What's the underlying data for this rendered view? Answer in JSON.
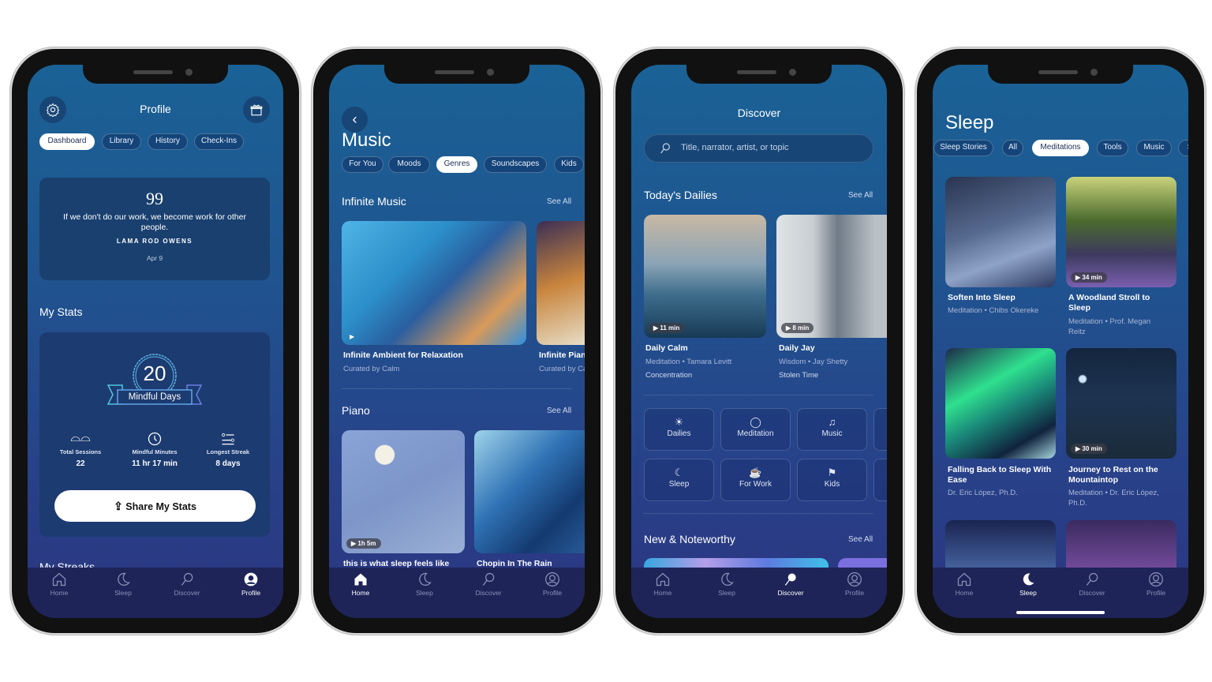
{
  "tabbar": {
    "home": "Home",
    "sleep": "Sleep",
    "discover": "Discover",
    "profile": "Profile"
  },
  "profile": {
    "title": "Profile",
    "tabs": [
      "Dashboard",
      "Library",
      "History",
      "Check-Ins"
    ],
    "quote": {
      "mark": "99",
      "text": "If we don't do our work, we become work for other people.",
      "author": "LAMA ROD OWENS",
      "date": "Apr 9"
    },
    "stats_heading": "My Stats",
    "badge": {
      "value": "20",
      "label": "Mindful Days"
    },
    "stats": [
      {
        "label": "Total Sessions",
        "value": "22"
      },
      {
        "label": "Mindful Minutes",
        "value": "11 hr 17 min"
      },
      {
        "label": "Longest Streak",
        "value": "8 days"
      }
    ],
    "share_label": "Share My Stats",
    "streaks_heading": "My Streaks"
  },
  "music": {
    "title": "Music",
    "tabs": [
      "For You",
      "Moods",
      "Genres",
      "Soundscapes",
      "Kids"
    ],
    "sections": [
      {
        "heading": "Infinite Music",
        "see_all": "See All",
        "items": [
          {
            "title": "Infinite Ambient for Relaxation",
            "subtitle": "Curated by Calm"
          },
          {
            "title": "Infinite Piano",
            "subtitle": "Curated by Calm"
          }
        ]
      },
      {
        "heading": "Piano",
        "see_all": "See All",
        "items": [
          {
            "title": "this is what sleep feels like",
            "duration": "1h 5m"
          },
          {
            "title": "Chopin In The Rain"
          }
        ]
      }
    ]
  },
  "discover": {
    "title": "Discover",
    "search_placeholder": "Title, narrator, artist, or topic",
    "dailies_heading": "Today's Dailies",
    "see_all": "See All",
    "dailies": [
      {
        "title": "Daily Calm",
        "meta": "Meditation • Tamara Levitt",
        "topic": "Concentration",
        "duration": "11 min"
      },
      {
        "title": "Daily Jay",
        "meta": "Wisdom • Jay Shetty",
        "topic": "Stolen Time",
        "duration": "8 min"
      }
    ],
    "categories": [
      "Dailies",
      "Meditation",
      "Music",
      "Sleep",
      "For Work",
      "Kids"
    ],
    "new_heading": "New & Noteworthy"
  },
  "sleep": {
    "title": "Sleep",
    "tabs": [
      "Sleep Stories",
      "All",
      "Meditations",
      "Tools",
      "Music",
      "S"
    ],
    "items": [
      {
        "title": "Soften Into Sleep",
        "meta": "Meditation • Chibs Okereke"
      },
      {
        "title": "A Woodland Stroll to Sleep",
        "meta": "Meditation • Prof. Megan Reitz",
        "duration": "34 min"
      },
      {
        "title": "Falling Back to Sleep With Ease",
        "meta": "Dr. Eric López, Ph.D."
      },
      {
        "title": "Journey to Rest on the Mountaintop",
        "meta": "Meditation • Dr. Eric López, Ph.D.",
        "duration": "30 min"
      }
    ]
  },
  "colors": {
    "accent": "#ffffff",
    "background_top": "#1a6296",
    "background_bottom": "#2b3580",
    "tabbar": "#1e2458"
  }
}
